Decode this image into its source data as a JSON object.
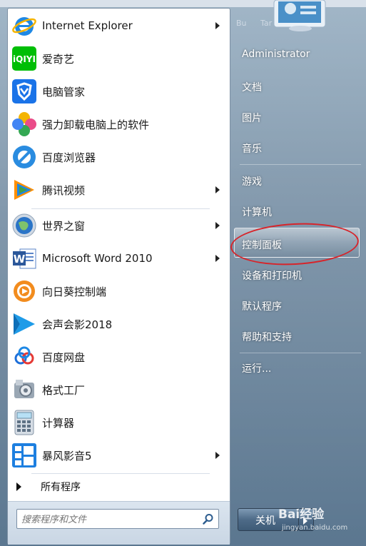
{
  "top_strip": {
    "fragments": [
      "Bu",
      "Tar"
    ]
  },
  "left_pane": {
    "items": [
      {
        "name": "internet-explorer",
        "label": "Internet Explorer",
        "icon": "ie-icon",
        "submenu": true
      },
      {
        "name": "iqiyi",
        "label": "爱奇艺",
        "icon": "iqiyi-icon",
        "submenu": false
      },
      {
        "name": "pc-manager",
        "label": "电脑管家",
        "icon": "tencent-pc-manager-icon",
        "submenu": false
      },
      {
        "name": "uninstaller",
        "label": "强力卸载电脑上的软件",
        "icon": "clover-icon",
        "submenu": false
      },
      {
        "name": "baidu-browser",
        "label": "百度浏览器",
        "icon": "baidu-browser-icon",
        "submenu": false
      },
      {
        "name": "tencent-video",
        "label": "腾讯视频",
        "icon": "tencent-video-icon",
        "submenu": true
      },
      {
        "name": "theworld",
        "label": "世界之窗",
        "icon": "globe-icon",
        "submenu": true
      },
      {
        "name": "word-2010",
        "label": "Microsoft Word 2010",
        "icon": "word-icon",
        "submenu": true
      },
      {
        "name": "sunlogin",
        "label": "向日葵控制端",
        "icon": "sunflower-icon",
        "submenu": false
      },
      {
        "name": "corel-video",
        "label": "会声会影2018",
        "icon": "corel-icon",
        "submenu": false
      },
      {
        "name": "baidu-netdisk",
        "label": "百度网盘",
        "icon": "cloud-icon",
        "submenu": false
      },
      {
        "name": "format-factory",
        "label": "格式工厂",
        "icon": "format-factory-icon",
        "submenu": false
      },
      {
        "name": "calculator",
        "label": "计算器",
        "icon": "calculator-icon",
        "submenu": false
      },
      {
        "name": "storm-player",
        "label": "暴风影音5",
        "icon": "storm-icon",
        "submenu": true
      }
    ],
    "all_programs": "所有程序",
    "search_placeholder": "搜索程序和文件"
  },
  "right_pane": {
    "items": [
      {
        "name": "administrator",
        "label": "Administrator"
      },
      {
        "name": "documents",
        "label": "文档"
      },
      {
        "name": "pictures",
        "label": "图片"
      },
      {
        "name": "music",
        "label": "音乐"
      },
      {
        "name": "games",
        "label": "游戏"
      },
      {
        "name": "computer",
        "label": "计算机"
      },
      {
        "name": "control-panel",
        "label": "控制面板"
      },
      {
        "name": "devices-printers",
        "label": "设备和打印机"
      },
      {
        "name": "default-programs",
        "label": "默认程序"
      },
      {
        "name": "help-support",
        "label": "帮助和支持"
      },
      {
        "name": "run",
        "label": "运行..."
      }
    ],
    "shutdown_label": "关机"
  },
  "watermark": {
    "text": "Bai经验",
    "url": "jingyan.baidu.com"
  },
  "colors": {
    "accent_red": "#d7242a",
    "start_panel": "#5a7791"
  }
}
